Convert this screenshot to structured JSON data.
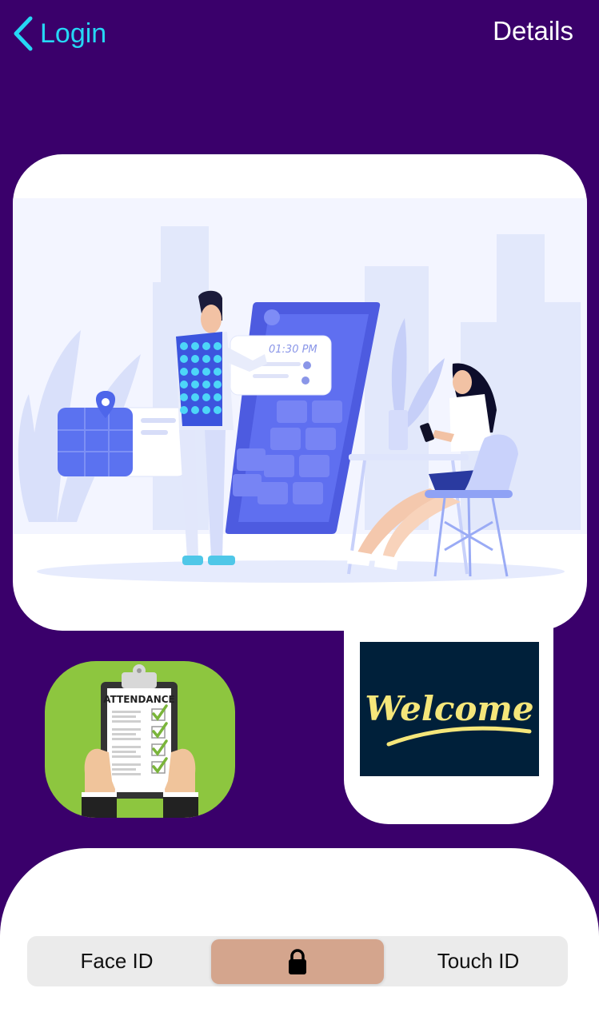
{
  "nav": {
    "back_label": "Login",
    "title": "Details"
  },
  "hero": {
    "illustration_time": "01:30 PM"
  },
  "attendance": {
    "label": "ATTENDANCE"
  },
  "welcome": {
    "text": "Welcome"
  },
  "segmented": {
    "items": [
      {
        "label": "Face ID"
      },
      {
        "icon": "lock-icon"
      },
      {
        "label": "Touch ID"
      }
    ],
    "selected": 1
  },
  "colors": {
    "background": "#3a006b",
    "accent": "#26d7f5",
    "selected_segment": "#d4a58d",
    "attendance_bg": "#8dc63f",
    "welcome_bg": "#00203a",
    "welcome_text": "#f5e67a"
  }
}
